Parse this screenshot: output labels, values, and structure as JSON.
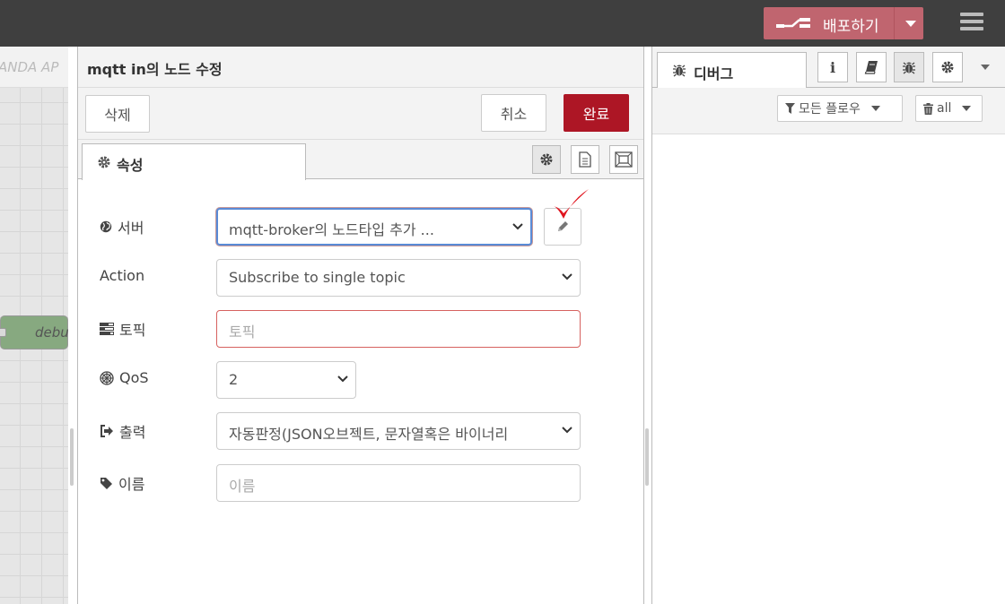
{
  "header": {
    "deploy_label": "배포하기"
  },
  "workspace": {
    "tab_label": "ANDA AP",
    "node_label": "debu"
  },
  "editor": {
    "title": "mqtt in의 노드 수정",
    "delete_label": "삭제",
    "cancel_label": "취소",
    "done_label": "완료",
    "properties_tab_label": "속성",
    "fields": {
      "server": {
        "label": "서버",
        "value": "mqtt-broker의 노드타입 추가 ..."
      },
      "action": {
        "label": "Action",
        "value": "Subscribe to single topic"
      },
      "topic": {
        "label": "토픽",
        "placeholder": "토픽"
      },
      "qos": {
        "label": "QoS",
        "value": "2"
      },
      "output": {
        "label": "출력",
        "value": "자동판정(JSON오브젝트, 문자열혹은 바이너리"
      },
      "name": {
        "label": "이름",
        "placeholder": "이름"
      }
    }
  },
  "sidebar": {
    "debug_tab_label": "디버그",
    "info_icon_glyph": "i",
    "filter_label": "모든 플로우",
    "clear_label": "all"
  },
  "colors": {
    "header_bg": "#3f3f3f",
    "deploy_bg": "#c0656f",
    "done_bg": "#ad1625",
    "checkmark": "#e0141e"
  }
}
